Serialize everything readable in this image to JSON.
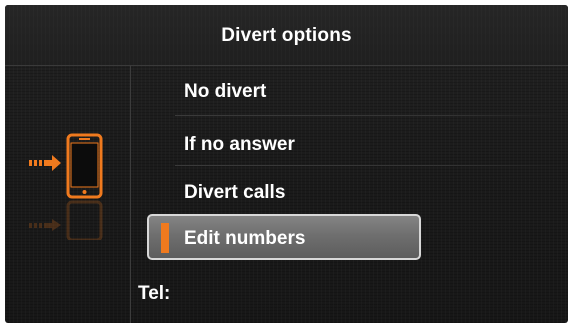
{
  "header": {
    "title": "Divert options"
  },
  "menu": {
    "items": [
      {
        "label": "No divert"
      },
      {
        "label": "If no answer"
      },
      {
        "label": "Divert calls"
      },
      {
        "label": "Edit numbers",
        "selected": true
      }
    ]
  },
  "tel": {
    "label": "Tel:",
    "value": ""
  },
  "icons": {
    "divert_graphic": "phone-divert-icon"
  },
  "colors": {
    "accent": "#f07a1e",
    "background": "#1c1c1c",
    "text": "#ffffff",
    "selection": "#6f6f6f"
  }
}
